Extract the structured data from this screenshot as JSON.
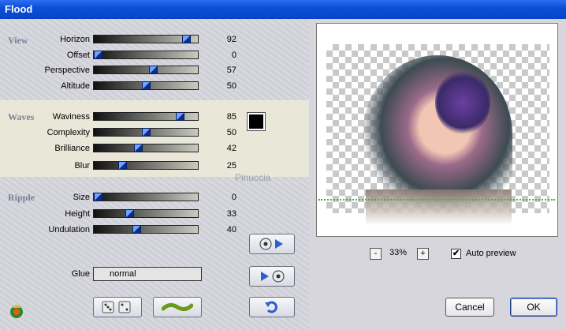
{
  "window": {
    "title": "Flood"
  },
  "sections": [
    {
      "label": "View",
      "sliders": [
        {
          "label": "Horizon",
          "value": 92
        },
        {
          "label": "Offset",
          "value": 0
        },
        {
          "label": "Perspective",
          "value": 57
        },
        {
          "label": "Altitude",
          "value": 50
        }
      ]
    },
    {
      "label": "Waves",
      "sliders": [
        {
          "label": "Waviness",
          "value": 85
        },
        {
          "label": "Complexity",
          "value": 50
        },
        {
          "label": "Brilliance",
          "value": 42
        },
        {
          "label": "Blur",
          "value": 25
        }
      ]
    },
    {
      "label": "Ripple",
      "sliders": [
        {
          "label": "Size",
          "value": 0
        },
        {
          "label": "Height",
          "value": 33
        },
        {
          "label": "Undulation",
          "value": 40
        }
      ]
    }
  ],
  "color_swatch": "#000000",
  "glue": {
    "label": "Glue",
    "value": "normal"
  },
  "zoom": {
    "minus": "-",
    "value": "33%",
    "plus": "+"
  },
  "auto_preview": {
    "label": "Auto preview",
    "checked": true,
    "mark": "✔"
  },
  "buttons": {
    "cancel": "Cancel",
    "ok": "OK"
  },
  "watermark": "Pinuccia",
  "icons": [
    "app-logo-icon",
    "dice-icon",
    "wave-icon",
    "play-forward-icon",
    "play-back-icon",
    "undo-icon"
  ]
}
